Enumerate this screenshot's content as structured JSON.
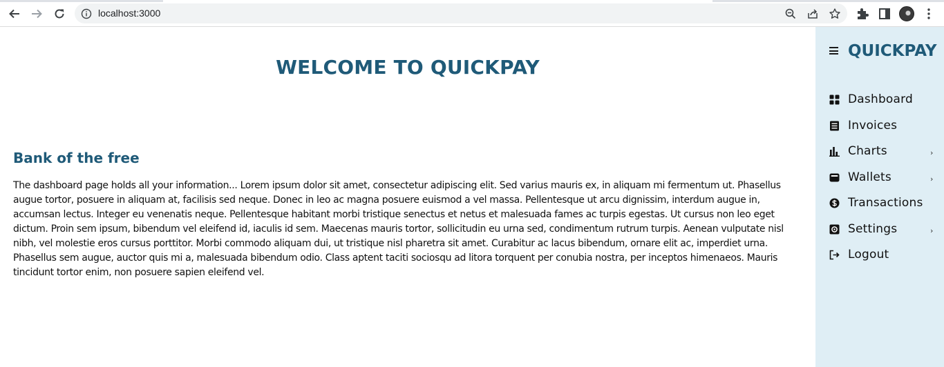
{
  "browser": {
    "url": "localhost:3000",
    "icons": [
      "back-arrow-icon",
      "forward-arrow-icon",
      "reload-icon",
      "info-icon",
      "zoom-out-icon",
      "share-icon",
      "bookmark-star-icon",
      "extensions-puzzle-icon",
      "side-panel-icon",
      "profile-avatar",
      "more-menu-icon"
    ]
  },
  "main": {
    "welcome_title": "WELCOME TO QUICKPAY",
    "section_title": "Bank of the free",
    "paragraph": "The dashboard page holds all your information... Lorem ipsum dolor sit amet, consectetur adipiscing elit. Sed varius mauris ex, in aliquam mi fermentum ut. Phasellus augue tortor, posuere in aliquam at, facilisis sed neque. Donec in leo ac magna posuere euismod a vel massa. Pellentesque ut arcu dignissim, interdum augue in, accumsan lectus. Integer eu venenatis neque. Pellentesque habitant morbi tristique senectus et netus et malesuada fames ac turpis egestas. Ut cursus non leo eget dictum. Proin sem ipsum, bibendum vel eleifend id, iaculis id sem. Maecenas mauris tortor, sollicitudin eu urna sed, condimentum rutrum turpis. Aenean vulputate nisl nibh, vel molestie eros cursus porttitor. Morbi commodo aliquam dui, ut tristique nisl pharetra sit amet. Curabitur ac lacus bibendum, ornare elit ac, imperdiet urna. Phasellus sem augue, auctor quis mi a, malesuada bibendum odio. Class aptent taciti sociosqu ad litora torquent per conubia nostra, per inceptos himenaeos. Mauris tincidunt tortor enim, non posuere sapien eleifend vel."
  },
  "sidebar": {
    "brand": "QUICKPAY",
    "items": [
      {
        "label": "Dashboard",
        "icon": "dashboard-grid-icon",
        "has_submenu": false
      },
      {
        "label": "Invoices",
        "icon": "invoice-document-icon",
        "has_submenu": false
      },
      {
        "label": "Charts",
        "icon": "bar-chart-icon",
        "has_submenu": true
      },
      {
        "label": "Wallets",
        "icon": "wallet-icon",
        "has_submenu": true
      },
      {
        "label": "Transactions",
        "icon": "dollar-circle-icon",
        "has_submenu": false
      },
      {
        "label": "Settings",
        "icon": "settings-gear-icon",
        "has_submenu": true
      },
      {
        "label": "Logout",
        "icon": "logout-icon",
        "has_submenu": false
      }
    ],
    "chevron": "›"
  },
  "colors": {
    "accent": "#1f5a78",
    "sidebar_bg": "#dfeef5",
    "text": "#111111"
  }
}
